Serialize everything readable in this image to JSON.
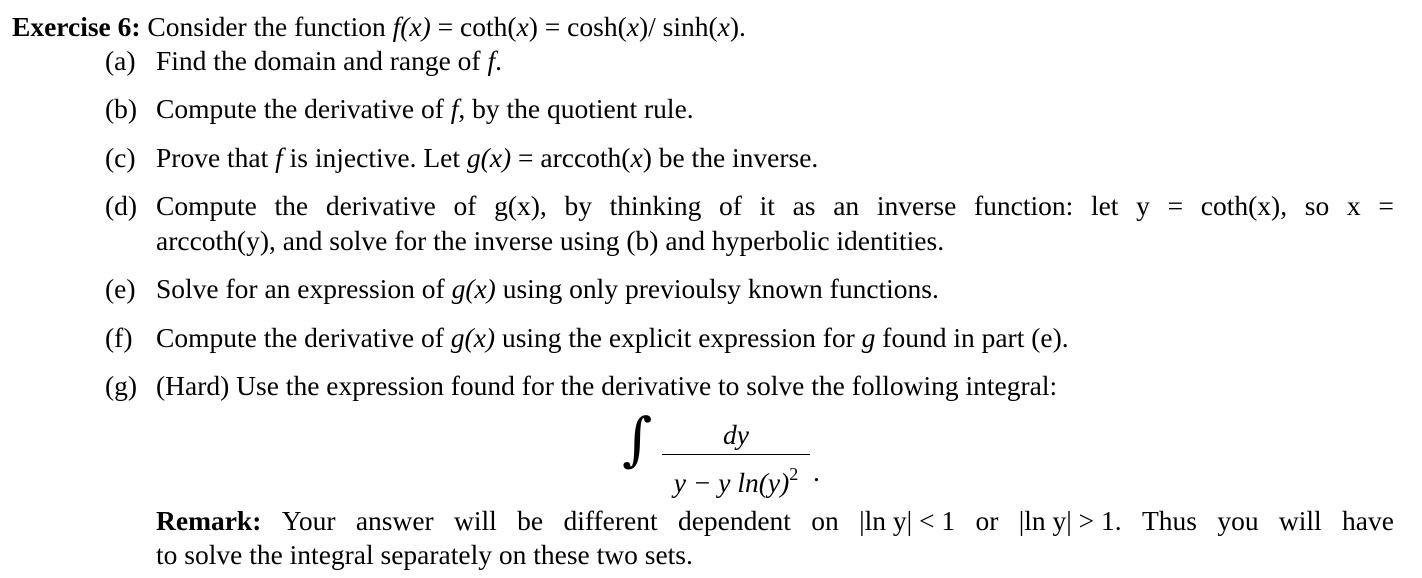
{
  "exercise": {
    "heading": "Exercise 6:",
    "intro": {
      "prefix": "Consider the function ",
      "f_of_x": "f(x)",
      "eq1": " = coth(",
      "x1": "x",
      "eq2": ") = cosh(",
      "x2": "x",
      "eq3": ")/ sinh(",
      "x3": "x",
      "suffix": ")."
    },
    "parts": [
      {
        "label": "(a)",
        "text_before": "Find the domain and range of ",
        "math": "f",
        "text_after": "."
      },
      {
        "label": "(b)",
        "text_before": "Compute the derivative of ",
        "math": "f",
        "text_after": ", by the quotient rule."
      },
      {
        "label": "(c)",
        "text_before": "Prove that ",
        "math": "f",
        "text_mid": " is injective. Let ",
        "math2": "g(x)",
        "text_after": " = arccoth(",
        "math3": "x",
        "text_end": ") be the inverse."
      },
      {
        "label": "(d)",
        "line1_words": [
          "Compute",
          "the",
          "derivative",
          "of",
          "g(x),",
          "by",
          "thinking",
          "of",
          "it",
          "as",
          "an",
          "inverse",
          "function:",
          "let",
          "y",
          "=",
          "coth(x),",
          "so",
          "x",
          "="
        ],
        "line2": "arccoth(y), and solve for the inverse using (b) and hyperbolic identities."
      },
      {
        "label": "(e)",
        "text_before": "Solve for an expression of ",
        "math": "g(x)",
        "text_after": " using only previoulsy known functions."
      },
      {
        "label": "(f)",
        "text_before": "Compute the derivative of ",
        "math": "g(x)",
        "text_mid": " using the explicit expression for ",
        "math2": "g",
        "text_after": " found in part (e)."
      },
      {
        "label": "(g)",
        "text": "(Hard) Use the expression found for the derivative to solve the following integral:"
      }
    ],
    "integral": {
      "sign": "∫",
      "numerator": "dy",
      "denominator_main": "y − y ln(y)",
      "denominator_exp": "2",
      "trailing": "."
    },
    "remark": {
      "label": "Remark:",
      "line1_words": [
        "Your",
        "answer",
        "will",
        "be",
        "different",
        "dependent",
        "on",
        "|ln y| < 1",
        "or",
        "|ln y| > 1.",
        "Thus",
        "you",
        "will",
        "have"
      ],
      "line2": "to solve the integral separately on these two sets."
    }
  }
}
